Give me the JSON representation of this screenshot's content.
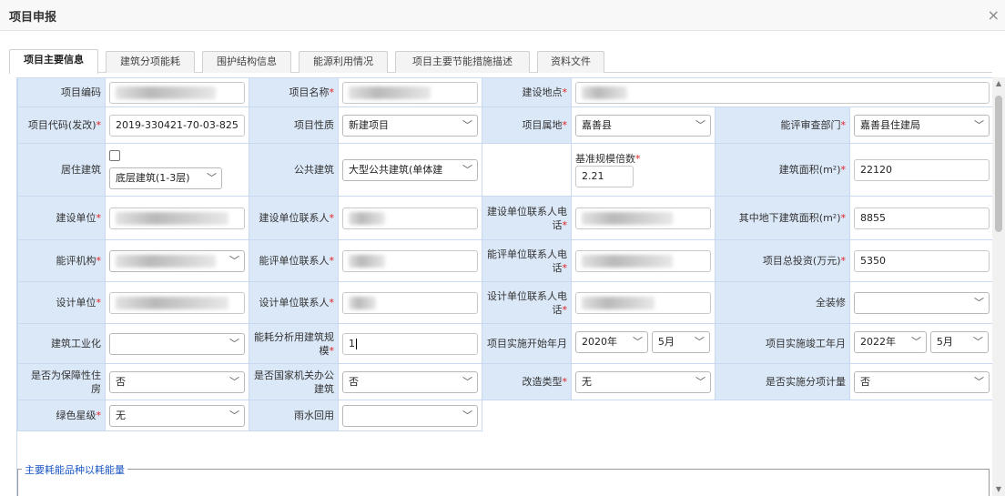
{
  "window": {
    "title": "项目申报",
    "close": "×"
  },
  "tabs": [
    "项目主要信息",
    "建筑分项能耗",
    "围护结构信息",
    "能源利用情况",
    "项目主要节能措施描述",
    "资料文件"
  ],
  "active_tab": 0,
  "required_mark": "*",
  "fields": {
    "project_code": {
      "label": "项目编码"
    },
    "project_name": {
      "label": "项目名称"
    },
    "build_location": {
      "label": "建设地点"
    },
    "reform_code": {
      "label": "项目代码(发改)",
      "value": "2019-330421-70-03-825"
    },
    "project_nature": {
      "label": "项目性质",
      "value": "新建项目"
    },
    "project_locality": {
      "label": "项目属地",
      "value": "嘉善县"
    },
    "review_dept": {
      "label": "能评审查部门",
      "value": "嘉善县住建局"
    },
    "residential": {
      "label": "居住建筑",
      "value": "底层建筑(1-3层)"
    },
    "public_building": {
      "label": "公共建筑",
      "value": "大型公共建筑(单体建"
    },
    "scale_multiple": {
      "label": "基准规模倍数",
      "value": "2.21"
    },
    "building_area": {
      "label": "建筑面积(m²)",
      "value": "22120"
    },
    "build_unit": {
      "label": "建设单位"
    },
    "build_contact": {
      "label": "建设单位联系人"
    },
    "build_phone": {
      "label": "建设单位联系人电话"
    },
    "underground_area": {
      "label": "其中地下建筑面积(m²)",
      "value": "8855"
    },
    "eval_org": {
      "label": "能评机构"
    },
    "eval_contact": {
      "label": "能评单位联系人"
    },
    "eval_phone": {
      "label": "能评单位联系人电话"
    },
    "total_investment": {
      "label": "项目总投资(万元)",
      "value": "5350"
    },
    "design_unit": {
      "label": "设计单位"
    },
    "design_contact": {
      "label": "设计单位联系人"
    },
    "design_phone": {
      "label": "设计单位联系人电话"
    },
    "full_decoration": {
      "label": "全装修",
      "value": ""
    },
    "industrialization": {
      "label": "建筑工业化",
      "value": ""
    },
    "analysis_scale": {
      "label": "能耗分析用建筑规模",
      "value": "1"
    },
    "start_month": {
      "label": "项目实施开始年月",
      "year": "2020年",
      "month": "5月"
    },
    "end_month": {
      "label": "项目实施竣工年月",
      "year": "2022年",
      "month": "5月"
    },
    "affordable_housing": {
      "label": "是否为保障性住房",
      "value": "否"
    },
    "govt_office": {
      "label": "是否国家机关办公建筑",
      "value": "否"
    },
    "reform_type": {
      "label": "改造类型",
      "value": "无"
    },
    "sub_metering": {
      "label": "是否实施分项计量",
      "value": "否"
    },
    "green_star": {
      "label": "绿色星级",
      "value": "无"
    },
    "rainwater": {
      "label": "雨水回用",
      "value": ""
    }
  },
  "subsection": {
    "title": "主要耗能品种以耗能量"
  },
  "icons": {
    "chevron": "chevron-down-icon",
    "close": "close-icon"
  }
}
